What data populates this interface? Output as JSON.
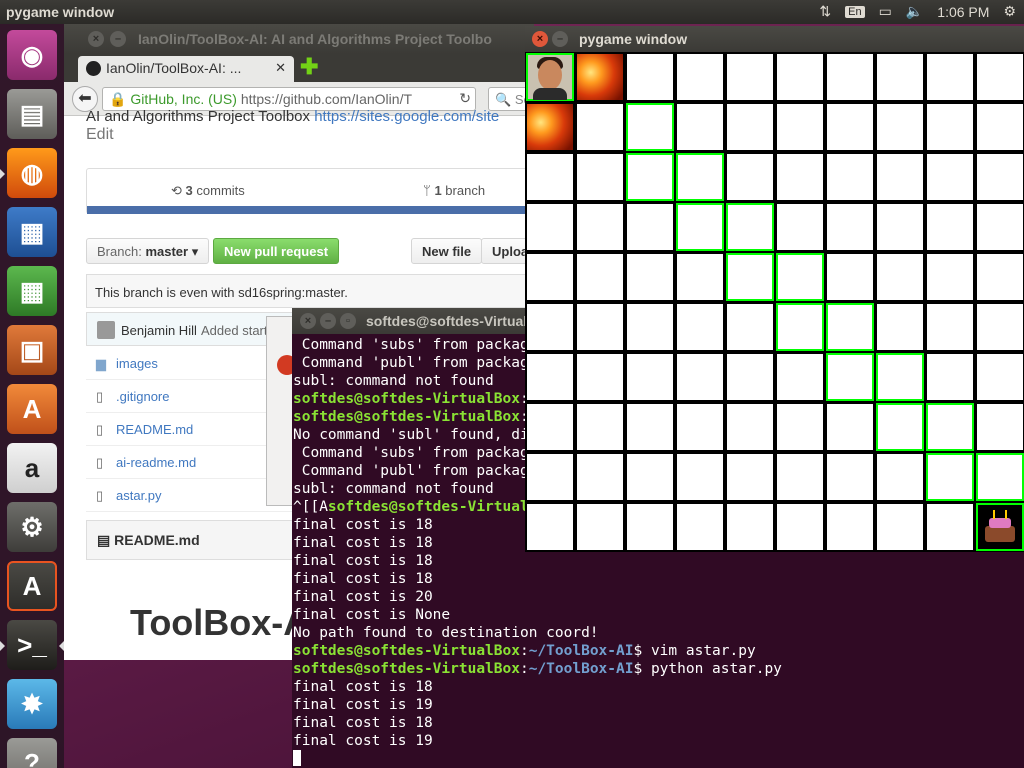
{
  "topbar": {
    "title": "pygame window",
    "keyboard": "En",
    "time": "1:06 PM"
  },
  "launcher": {
    "items": [
      "ubuntu-dash",
      "files",
      "firefox",
      "writer",
      "calc",
      "impress",
      "software-center",
      "amazon",
      "system-settings",
      "software-updater",
      "terminal",
      "workspace-switcher",
      "help"
    ]
  },
  "browser": {
    "window_title": "IanOlin/ToolBox-AI: AI and Algorithms Project Toolbo",
    "tab_title": "IanOlin/ToolBox-AI: ...",
    "url_org": "GitHub, Inc. (US)",
    "url": "https://github.com/IanOlin/T",
    "search_placeholder": "Se",
    "repo_desc": "AI and Algorithms Project Toolbox",
    "repo_link": "https://sites.google.com/site",
    "edit": "Edit",
    "commits_count": "3",
    "commits_label": "commits",
    "branch_count": "1",
    "branch_label": "branch",
    "branch_prefix": "Branch:",
    "branch_name": "master",
    "new_pr": "New pull request",
    "new_file": "New file",
    "upload": "Uploa",
    "even_msg": "This branch is even with sd16spring:master.",
    "committer": "Benjamin Hill",
    "commit_msg": "Added start",
    "files": [
      {
        "icon": "folder-icon",
        "name": "images"
      },
      {
        "icon": "file-icon",
        "name": ".gitignore"
      },
      {
        "icon": "file-icon",
        "name": "README.md"
      },
      {
        "icon": "file-icon",
        "name": "ai-readme.md"
      },
      {
        "icon": "file-icon",
        "name": "astar.py"
      }
    ],
    "readme_header": "README.md",
    "readme_title": "ToolBox-AI"
  },
  "terminal": {
    "title": "softdes@softdes-VirtualBox: ~/ToolBox-AI",
    "prompt_user": "softdes@softdes-VirtualBox",
    "prompt_path": "~/ToolBox-AI",
    "lines": [
      {
        "t": "out",
        "text": " Command 'subs' from package"
      },
      {
        "t": "out",
        "text": " Command 'publ' from package"
      },
      {
        "t": "out",
        "text": "subl: command not found"
      },
      {
        "t": "prompt_only",
        "text": ""
      },
      {
        "t": "prompt_only",
        "text": ""
      },
      {
        "t": "out",
        "text": "No command 'subl' found, did you mean:"
      },
      {
        "t": "out",
        "text": " Command 'subs' from package"
      },
      {
        "t": "out",
        "text": " Command 'publ' from package"
      },
      {
        "t": "out",
        "text": "subl: command not found"
      },
      {
        "t": "esc",
        "text": "^[[A"
      },
      {
        "t": "out",
        "text": "final cost is 18"
      },
      {
        "t": "out",
        "text": "final cost is 18"
      },
      {
        "t": "out",
        "text": "final cost is 18"
      },
      {
        "t": "out",
        "text": "final cost is 18"
      },
      {
        "t": "out",
        "text": "final cost is 20"
      },
      {
        "t": "out",
        "text": "final cost is None"
      },
      {
        "t": "out",
        "text": "No path found to destination coord!"
      },
      {
        "t": "cmd",
        "text": "vim astar.py"
      },
      {
        "t": "cmd",
        "text": "python astar.py"
      },
      {
        "t": "out",
        "text": "final cost is 18"
      },
      {
        "t": "out",
        "text": "final cost is 19"
      },
      {
        "t": "out",
        "text": "final cost is 18"
      },
      {
        "t": "out",
        "text": "final cost is 19"
      }
    ]
  },
  "pygame": {
    "title": "pygame window",
    "rows": 10,
    "cols": 10,
    "lava_cells": [
      [
        0,
        1
      ],
      [
        1,
        0
      ]
    ],
    "player_cell": [
      0,
      0
    ],
    "goal_cell": [
      9,
      9
    ],
    "path_cells": [
      [
        0,
        0
      ],
      [
        1,
        2
      ],
      [
        2,
        2
      ],
      [
        2,
        3
      ],
      [
        3,
        3
      ],
      [
        3,
        4
      ],
      [
        4,
        4
      ],
      [
        4,
        5
      ],
      [
        5,
        5
      ],
      [
        5,
        6
      ],
      [
        6,
        6
      ],
      [
        6,
        7
      ],
      [
        7,
        7
      ],
      [
        7,
        8
      ],
      [
        8,
        8
      ],
      [
        8,
        9
      ],
      [
        9,
        9
      ]
    ],
    "path_color": "#00ff00"
  }
}
